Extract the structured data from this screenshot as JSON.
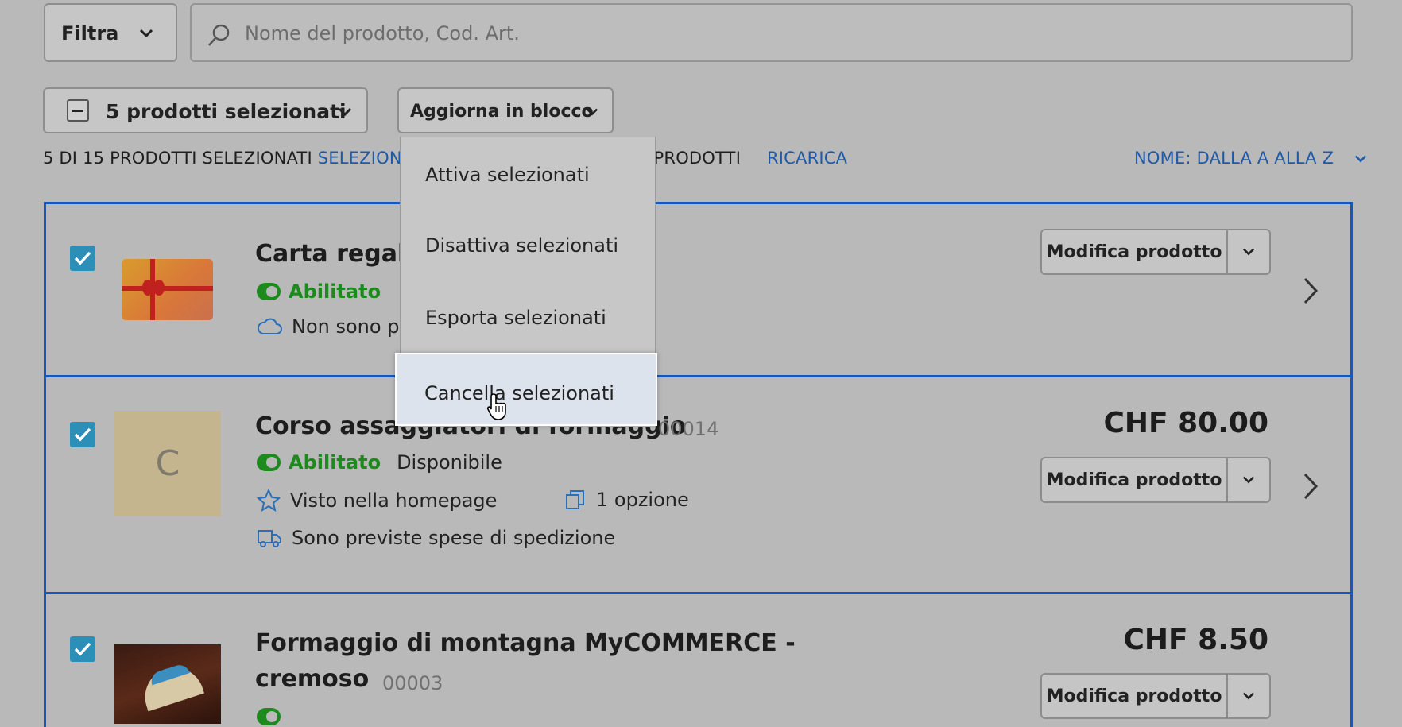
{
  "toolbar": {
    "filter_label": "Filtra",
    "search_placeholder": "Nome del prodotto, Cod. Art.",
    "selection_label": "5 prodotti selezionati",
    "bulk_update_label": "Aggiorna in blocco"
  },
  "info": {
    "count_text": "5 DI 15 PRODOTTI SELEZIONATI",
    "select_all_partial": "SELEZIONA T",
    "deselect_partial": "I I PRODOTTI",
    "reload": "RICARICA",
    "sort": "NOME: DALLA A ALLA Z"
  },
  "bulk_menu": {
    "items": [
      "Attiva selezionati",
      "Disattiva selezionati",
      "Esporta selezionati",
      "Cancella selezionati"
    ]
  },
  "products": [
    {
      "title": "Carta regalo",
      "status": "Abilitato",
      "shipping_partial": "Non sono pr",
      "edit_label": "Modifica prodotto"
    },
    {
      "title": "Corso assaggiatori di formaggio",
      "sku": "00014",
      "status": "Abilitato",
      "availability": "Disponibile",
      "homepage": "Visto nella homepage",
      "options": "1 opzione",
      "shipping": "Sono previste spese di spedizione",
      "price": "CHF 80.00",
      "thumb_letter": "C",
      "edit_label": "Modifica prodotto"
    },
    {
      "title_line1": "Formaggio di montagna MyCOMMERCE -",
      "title_line2": "cremoso",
      "sku": "00003",
      "price": "CHF 8.50",
      "edit_label": "Modifica prodotto"
    }
  ]
}
